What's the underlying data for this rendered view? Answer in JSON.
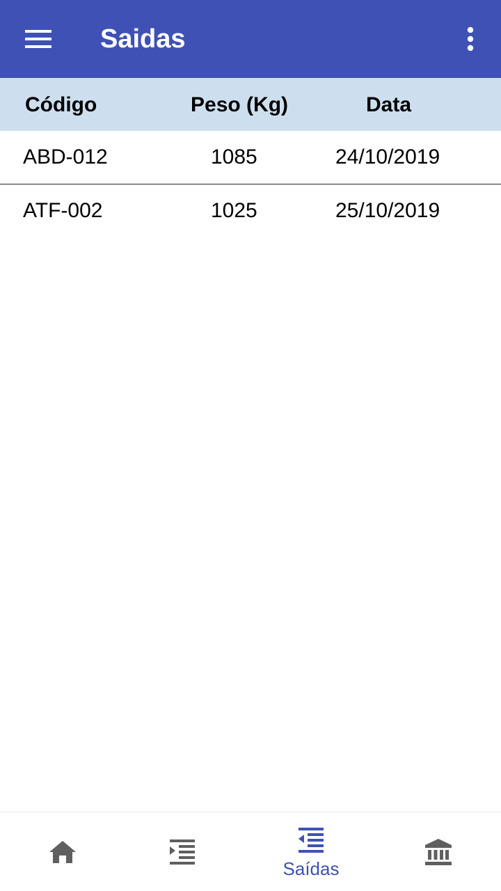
{
  "appbar": {
    "title": "Saidas",
    "menu_icon": "hamburger-menu-icon",
    "overflow_icon": "more-vert-icon",
    "color": "#3f51b5"
  },
  "table": {
    "header_color": "#cddfee",
    "columns": [
      "Código",
      "Peso (Kg)",
      "Data"
    ],
    "rows": [
      [
        "ABD-012",
        "1085",
        "24/10/2019"
      ],
      [
        "ATF-002",
        "1025",
        "25/10/2019"
      ]
    ]
  },
  "bottom_nav": {
    "active_color": "#3f51b5",
    "inactive_color": "#5f5f5f",
    "items": [
      {
        "icon": "home-icon",
        "label": "",
        "active": false
      },
      {
        "icon": "format-indent-increase-icon",
        "label": "",
        "active": false
      },
      {
        "icon": "format-indent-decrease-icon",
        "label": "Saídas",
        "active": true
      },
      {
        "icon": "bank-icon",
        "label": "",
        "active": false
      }
    ]
  }
}
